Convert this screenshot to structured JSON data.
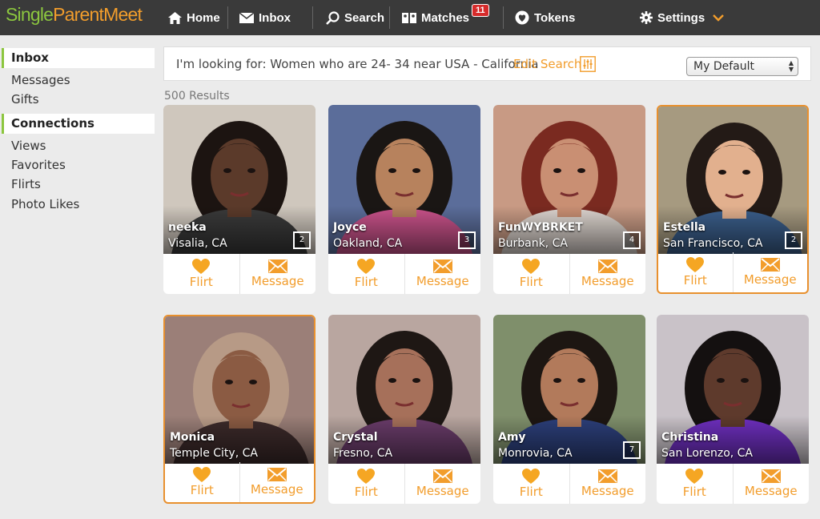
{
  "brand": {
    "part1": "Single",
    "part2": "ParentMeet"
  },
  "nav": {
    "home": "Home",
    "inbox": "Inbox",
    "search": "Search",
    "matches": "Matches",
    "matches_badge": "11",
    "tokens": "Tokens",
    "settings": "Settings"
  },
  "sidebar": {
    "inbox_head": "Inbox",
    "inbox_items": [
      "Messages",
      "Gifts"
    ],
    "connections_head": "Connections",
    "connection_items": [
      "Views",
      "Favorites",
      "Flirts",
      "Photo Likes"
    ]
  },
  "search": {
    "criteria": "I'm looking for: Women who are 24- 34 near USA - California",
    "edit_label": "Edit Search",
    "sort_value": "My Default",
    "results": "500 Results"
  },
  "actions": {
    "flirt": "Flirt",
    "message": "Message"
  },
  "profiles": [
    {
      "name": "neeka",
      "location": "Visalia, CA",
      "photos": "2",
      "bg": "#cfc7bd",
      "skin": "#5b3a2a",
      "hair": "#1c1411",
      "top": "#3a3a3a"
    },
    {
      "name": "Joyce",
      "location": "Oakland, CA",
      "photos": "3",
      "bg": "#5b6d9a",
      "skin": "#b7825d",
      "hair": "#1a1614",
      "top": "#c9528a"
    },
    {
      "name": "FunWYBRKET",
      "location": "Burbank, CA",
      "photos": "4",
      "bg": "#c89a84",
      "skin": "#c98f73",
      "hair": "#7a2a20",
      "top": "#ddd5cf"
    },
    {
      "name": "Estella",
      "location": "San Francisco, CA",
      "photos": "2",
      "bg": "#a69a80",
      "skin": "#e2b08e",
      "hair": "#231a16",
      "top": "#3b5f8c"
    },
    {
      "name": "Monica",
      "location": "Temple City, CA",
      "photos": "",
      "bg": "#9b7f78",
      "skin": "#8b5b43",
      "hair": "#b79a86",
      "top": "#3c2a2a"
    },
    {
      "name": "Crystal",
      "location": "Fresno, CA",
      "photos": "",
      "bg": "#b9a6a0",
      "skin": "#a6705a",
      "hair": "#1e1714",
      "top": "#6a3c6a"
    },
    {
      "name": "Amy",
      "location": "Monrovia, CA",
      "photos": "7",
      "bg": "#7f8f6b",
      "skin": "#b27a5b",
      "hair": "#1d1612",
      "top": "#2c3f7a"
    },
    {
      "name": "Christina",
      "location": "San Lorenzo, CA",
      "photos": "",
      "bg": "#c9c2c8",
      "skin": "#5e3a2c",
      "hair": "#141010",
      "top": "#6e2fbf"
    }
  ]
}
